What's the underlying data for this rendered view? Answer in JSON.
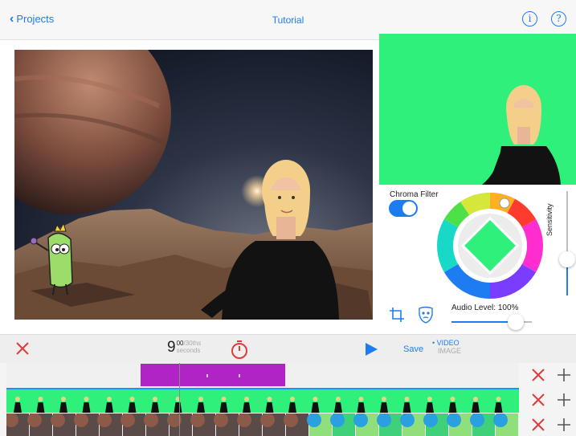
{
  "header": {
    "back_label": "Projects",
    "title": "Tutorial",
    "info_glyph": "i",
    "help_glyph": "?"
  },
  "panel": {
    "chroma_filter_label": "Chroma Filter",
    "chroma_filter_on": true,
    "sensitivity_label": "Sensitivity",
    "sensitivity_level": 0.35,
    "audio_level_label": "Audio Level: 100%",
    "audio_level": 1.0,
    "key_color": "#2ef07a"
  },
  "toolbar": {
    "time_seconds": "9",
    "time_frames": "00",
    "time_frames_unit": "/30ths",
    "time_unit": "seconds",
    "save_label": "Save",
    "mode_video": "VIDEO",
    "mode_image": "IMAGE"
  },
  "colors": {
    "accent": "#1e7cf2",
    "danger": "#e03b3b",
    "audio_clip": "#b024c6",
    "green_screen": "#2ef07a"
  }
}
